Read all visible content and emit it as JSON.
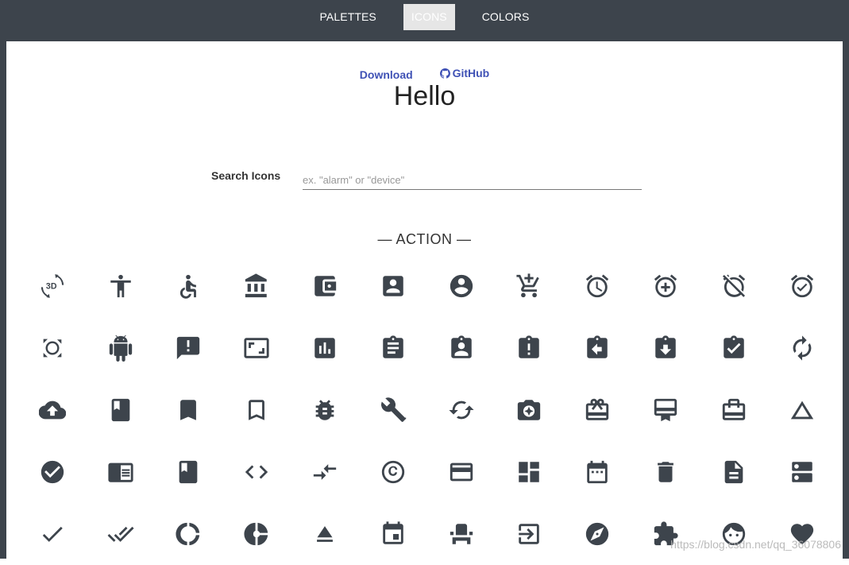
{
  "nav": {
    "items": [
      "PALETTES",
      "ICONS",
      "COLORS"
    ],
    "active": "ICONS"
  },
  "links": {
    "download": "Download",
    "github": "GitHub"
  },
  "title": "Hello",
  "search": {
    "label": "Search Icons",
    "placeholder": "ex. \"alarm\" or \"device\""
  },
  "section": {
    "title": "— ACTION —"
  },
  "icons": [
    "3d-rotation-icon",
    "accessibility-icon",
    "accessible-icon",
    "account-balance-icon",
    "account-balance-wallet-icon",
    "account-box-icon",
    "account-circle-icon",
    "add-shopping-cart-icon",
    "alarm-icon",
    "alarm-add-icon",
    "alarm-off-icon",
    "alarm-on-icon",
    "all-out-icon",
    "android-icon",
    "announcement-icon",
    "aspect-ratio-icon",
    "assessment-icon",
    "assignment-icon",
    "assignment-ind-icon",
    "assignment-late-icon",
    "assignment-return-icon",
    "assignment-returned-icon",
    "assignment-turned-in-icon",
    "autorenew-icon",
    "backup-icon",
    "book-icon",
    "bookmark-icon",
    "bookmark-border-icon",
    "bug-report-icon",
    "build-icon",
    "cached-icon",
    "camera-enhance-icon",
    "card-giftcard-icon",
    "card-membership-icon",
    "card-travel-icon",
    "change-history-icon",
    "check-circle-icon",
    "chrome-reader-mode-icon",
    "class-icon",
    "code-icon",
    "compare-arrows-icon",
    "copyright-icon",
    "credit-card-icon",
    "dashboard-icon",
    "date-range-icon",
    "delete-icon",
    "description-icon",
    "dns-icon",
    "done-icon",
    "done-all-icon",
    "donut-large-icon",
    "donut-small-icon",
    "eject-icon",
    "event-icon",
    "event-seat-icon",
    "exit-to-app-icon",
    "explore-icon",
    "extension-icon",
    "face-icon",
    "favorite-icon"
  ],
  "watermark": "https://blog.csdn.net/qq_36078806"
}
